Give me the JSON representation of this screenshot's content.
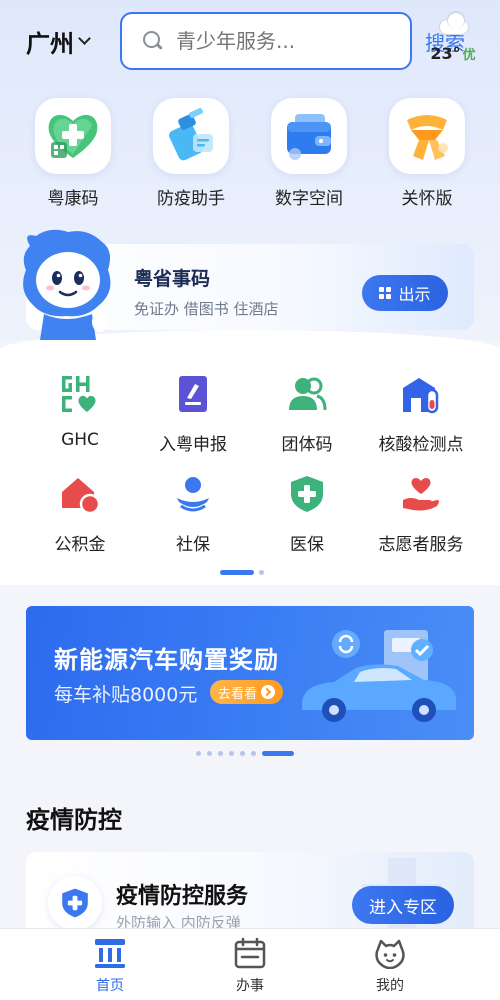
{
  "header": {
    "city": "广州",
    "search_placeholder": "青少年服务...",
    "search_button": "搜索",
    "weather": {
      "temp": "23°",
      "aqi": "优",
      "icon": "cloud-rain-icon"
    }
  },
  "quick_actions": [
    {
      "label": "粤康码",
      "icon": "health-heart-icon"
    },
    {
      "label": "防疫助手",
      "icon": "spray-bottle-icon"
    },
    {
      "label": "数字空间",
      "icon": "wallet-cards-icon"
    },
    {
      "label": "关怀版",
      "icon": "scarf-icon"
    }
  ],
  "code_card": {
    "title": "粤省事码",
    "subtitle": "免证办 借图书 住酒店",
    "button": "出示"
  },
  "services": [
    {
      "label": "GHC",
      "icon": "ghc-icon",
      "color": "#3db27a"
    },
    {
      "label": "入粤申报",
      "icon": "form-pen-icon",
      "color": "#5b52d6"
    },
    {
      "label": "团体码",
      "icon": "group-people-icon",
      "color": "#3db27a"
    },
    {
      "label": "核酸检测点",
      "icon": "test-site-icon",
      "color": "#3364e8"
    },
    {
      "label": "公积金",
      "icon": "house-fund-icon",
      "color": "#e74c4c"
    },
    {
      "label": "社保",
      "icon": "social-security-icon",
      "color": "#3b78f0"
    },
    {
      "label": "医保",
      "icon": "medical-shield-icon",
      "color": "#3db27a"
    },
    {
      "label": "志愿者服务",
      "icon": "heart-hand-icon",
      "color": "#e74c4c"
    }
  ],
  "banner": {
    "title": "新能源汽车购置奖励",
    "subtitle": "每车补贴8000元",
    "button": "去看看"
  },
  "section": {
    "title": "疫情防控"
  },
  "epidemic_card": {
    "title": "疫情防控服务",
    "subtitle": "外防输入 内防反弹",
    "button": "进入专区"
  },
  "tabbar": [
    {
      "label": "首页",
      "icon": "home-icon",
      "active": true
    },
    {
      "label": "办事",
      "icon": "calendar-icon",
      "active": false
    },
    {
      "label": "我的",
      "icon": "face-icon",
      "active": false
    }
  ],
  "colors": {
    "primary": "#3b78f0",
    "accent_orange": "#ff9a1f",
    "green": "#3db27a",
    "red": "#e74c4c"
  }
}
